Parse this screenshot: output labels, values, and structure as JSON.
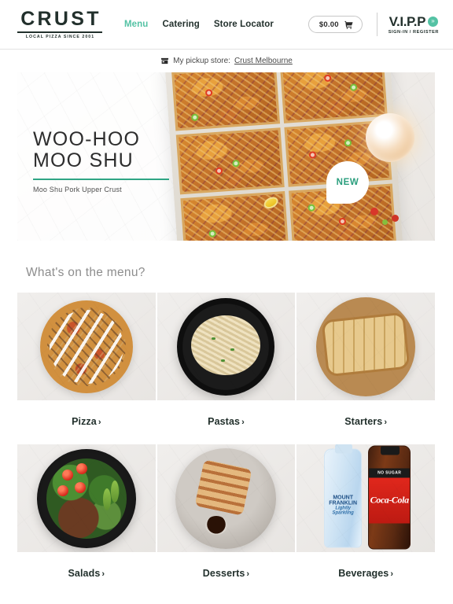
{
  "header": {
    "brand": {
      "word": "CRUST",
      "tagline": "LOCAL PIZZA SINCE 2001"
    },
    "nav": [
      {
        "label": "Menu",
        "active": true
      },
      {
        "label": "Catering",
        "active": false
      },
      {
        "label": "Store Locator",
        "active": false
      }
    ],
    "cart": {
      "amount": "$0.00",
      "icon": "cart-icon"
    },
    "vipp": {
      "word": "V.I.P.P",
      "badge_icon": "double-chevron-right-icon",
      "subtitle": "SIGN-IN / REGISTER"
    }
  },
  "pickup": {
    "icon": "store-icon",
    "label": "My pickup store:",
    "store_name": "Crust Melbourne"
  },
  "hero": {
    "title": "WOO-HOO\nMOO SHU",
    "subtitle": "Moo Shu Pork Upper Crust",
    "badge": "NEW",
    "accent_color": "#2fa584"
  },
  "menu_section": {
    "heading": "What's on the menu?",
    "chevron": "›",
    "tiles": [
      {
        "label": "Pizza",
        "image": "pizza-photo"
      },
      {
        "label": "Pastas",
        "image": "pasta-photo"
      },
      {
        "label": "Starters",
        "image": "garlic-bread-photo"
      },
      {
        "label": "Salads",
        "image": "salad-photo"
      },
      {
        "label": "Desserts",
        "image": "waffle-dessert-photo"
      },
      {
        "label": "Beverages",
        "image": "drinks-photo"
      }
    ]
  },
  "beverages_art": {
    "water_brand": "MOUNT\nFRANKLIN",
    "water_sub": "Lightly Sparkling",
    "coke_band": "NO SUGAR",
    "coke_brand": "Coca-Cola"
  },
  "colors": {
    "accent_teal": "#54c2a4",
    "hero_rule": "#2fa584",
    "ink": "#22302c",
    "muted": "#8d8d8d"
  }
}
